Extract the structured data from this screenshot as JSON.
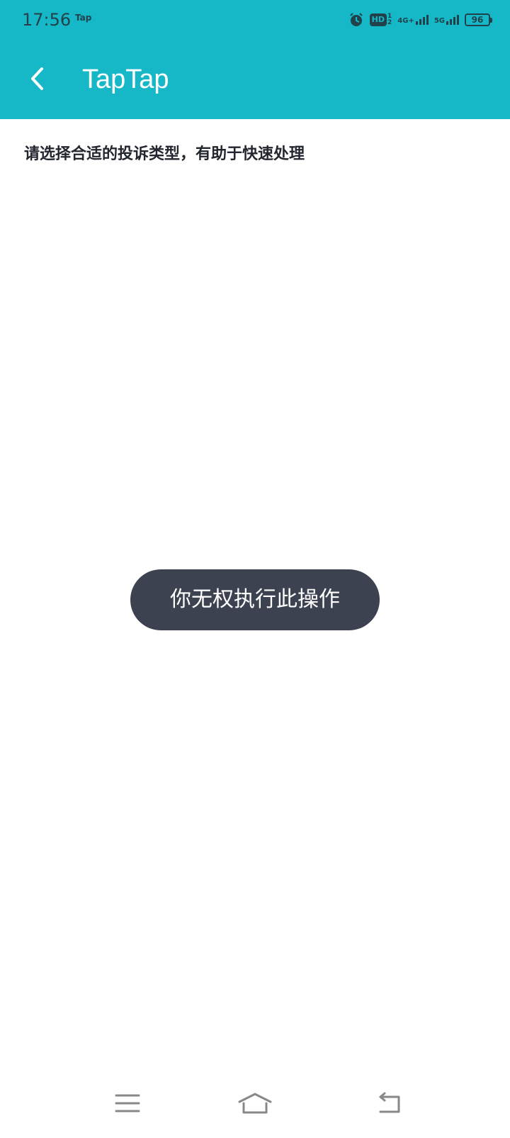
{
  "status_bar": {
    "time": "17:56",
    "app_label": "Tap",
    "hd_label": "HD",
    "network_4g": "4G+",
    "network_5g": "5G",
    "battery": "96"
  },
  "app_bar": {
    "title": "TapTap"
  },
  "content": {
    "instruction": "请选择合适的投诉类型，有助于快速处理"
  },
  "toast": {
    "message": "你无权执行此操作"
  },
  "colors": {
    "accent": "#16b8c8",
    "toast_bg": "#3d4250",
    "text_dark": "#22262e"
  },
  "icons": {
    "back": "chevron-left-icon",
    "alarm": "alarm-icon",
    "signal": "signal-bars-icon",
    "nav_menu": "menu-icon",
    "nav_home": "home-icon",
    "nav_back": "back-arrow-icon"
  }
}
